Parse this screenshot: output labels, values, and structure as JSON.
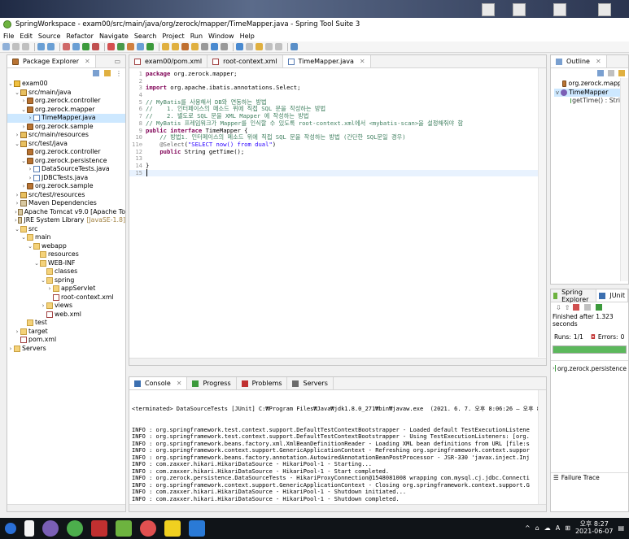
{
  "window": {
    "title": "SpringWorkspace - exam00/src/main/java/org/zerock/mapper/TimeMapper.java - Spring Tool Suite 3"
  },
  "menu": [
    "File",
    "Edit",
    "Source",
    "Refactor",
    "Navigate",
    "Search",
    "Project",
    "Run",
    "Window",
    "Help"
  ],
  "package_explorer": {
    "title": "Package Explorer",
    "rows": [
      {
        "indent": 0,
        "arrow": "v",
        "icon": "proj",
        "label": "exam00"
      },
      {
        "indent": 1,
        "arrow": "v",
        "icon": "src",
        "label": "src/main/java"
      },
      {
        "indent": 2,
        "arrow": ">",
        "icon": "pkg",
        "label": "org.zerock.controller"
      },
      {
        "indent": 2,
        "arrow": "v",
        "icon": "pkg",
        "label": "org.zerock.mapper"
      },
      {
        "indent": 3,
        "arrow": ">",
        "icon": "java",
        "label": "TimeMapper.java",
        "selected": true
      },
      {
        "indent": 2,
        "arrow": ">",
        "icon": "pkg",
        "label": "org.zerock.sample"
      },
      {
        "indent": 1,
        "arrow": ">",
        "icon": "src",
        "label": "src/main/resources"
      },
      {
        "indent": 1,
        "arrow": "v",
        "icon": "src",
        "label": "src/test/java"
      },
      {
        "indent": 2,
        "arrow": "",
        "icon": "pkg",
        "label": "org.zerock.controller"
      },
      {
        "indent": 2,
        "arrow": "v",
        "icon": "pkg",
        "label": "org.zerock.persistence"
      },
      {
        "indent": 3,
        "arrow": ">",
        "icon": "java",
        "label": "DataSourceTests.java"
      },
      {
        "indent": 3,
        "arrow": ">",
        "icon": "java",
        "label": "JDBCTests.java"
      },
      {
        "indent": 2,
        "arrow": ">",
        "icon": "pkg",
        "label": "org.zerock.sample"
      },
      {
        "indent": 1,
        "arrow": ">",
        "icon": "src",
        "label": "src/test/resources"
      },
      {
        "indent": 1,
        "arrow": ">",
        "icon": "lib",
        "label": "Maven Dependencies"
      },
      {
        "indent": 1,
        "arrow": ">",
        "icon": "lib",
        "label": "Apache Tomcat v9.0 [Apache To"
      },
      {
        "indent": 1,
        "arrow": ">",
        "icon": "lib",
        "label": "JRE System Library",
        "extra": "[JavaSE-1.8]"
      },
      {
        "indent": 1,
        "arrow": "v",
        "icon": "folder",
        "label": "src"
      },
      {
        "indent": 2,
        "arrow": "v",
        "icon": "folder",
        "label": "main"
      },
      {
        "indent": 3,
        "arrow": "v",
        "icon": "folder",
        "label": "webapp"
      },
      {
        "indent": 4,
        "arrow": "",
        "icon": "folder",
        "label": "resources"
      },
      {
        "indent": 4,
        "arrow": "v",
        "icon": "folder",
        "label": "WEB-INF"
      },
      {
        "indent": 5,
        "arrow": "",
        "icon": "folder",
        "label": "classes"
      },
      {
        "indent": 5,
        "arrow": "v",
        "icon": "folder",
        "label": "spring"
      },
      {
        "indent": 6,
        "arrow": ">",
        "icon": "folder",
        "label": "appServlet"
      },
      {
        "indent": 6,
        "arrow": "",
        "icon": "xml",
        "label": "root-context.xml"
      },
      {
        "indent": 5,
        "arrow": ">",
        "icon": "folder",
        "label": "views"
      },
      {
        "indent": 5,
        "arrow": "",
        "icon": "xml",
        "label": "web.xml"
      },
      {
        "indent": 2,
        "arrow": "",
        "icon": "folder",
        "label": "test"
      },
      {
        "indent": 1,
        "arrow": ">",
        "icon": "folder",
        "label": "target"
      },
      {
        "indent": 1,
        "arrow": "",
        "icon": "xml",
        "label": "pom.xml"
      },
      {
        "indent": 0,
        "arrow": ">",
        "icon": "folder",
        "label": "Servers"
      }
    ]
  },
  "editor": {
    "tabs": [
      {
        "label": "exam00/pom.xml",
        "active": false
      },
      {
        "label": "root-context.xml",
        "active": false
      },
      {
        "label": "TimeMapper.java",
        "active": true
      }
    ],
    "lines": [
      {
        "n": "1",
        "parts": [
          {
            "c": "kw",
            "t": "package"
          },
          {
            "c": "",
            "t": " org.zerock.mapper;"
          }
        ]
      },
      {
        "n": "2",
        "parts": []
      },
      {
        "n": "3",
        "parts": [
          {
            "c": "kw",
            "t": "import"
          },
          {
            "c": "",
            "t": " org.apache.ibatis.annotations.Select;"
          }
        ]
      },
      {
        "n": "4",
        "parts": []
      },
      {
        "n": "5",
        "parts": [
          {
            "c": "cm",
            "t": "// MyBatis를 사용해서 DB와 연동하는 방법"
          }
        ]
      },
      {
        "n": "6",
        "parts": [
          {
            "c": "cm",
            "t": "//    1. 인터페이스의 메소드 위에 직접 SQL 문을 작성하는 방법"
          }
        ]
      },
      {
        "n": "7",
        "parts": [
          {
            "c": "cm",
            "t": "//    2. 별도로 SQL 문을 XML Mapper 에 작성하는 방법"
          }
        ]
      },
      {
        "n": "8",
        "parts": [
          {
            "c": "cm",
            "t": "// MyBatis 프레임워크가 Mapper를 인식할 수 있도록 root-context.xml에서 <mybatis-scan>을 설정해줘야 함"
          }
        ]
      },
      {
        "n": "9",
        "parts": [
          {
            "c": "kw",
            "t": "public interface"
          },
          {
            "c": "",
            "t": " TimeMapper {"
          }
        ]
      },
      {
        "n": "10",
        "parts": [
          {
            "c": "cm",
            "t": "    // 방법1. 인터페이스의 메소드 위에 직접 SQL 문을 작성하는 방법 (간단한 SQL문일 경우)"
          }
        ]
      },
      {
        "n": "11⊖",
        "parts": [
          {
            "c": "an",
            "t": "    @Select"
          },
          {
            "c": "",
            "t": "("
          },
          {
            "c": "st",
            "t": "\"SELECT now() from dual\""
          },
          {
            "c": "",
            "t": ")"
          }
        ]
      },
      {
        "n": "12",
        "parts": [
          {
            "c": "",
            "t": "    "
          },
          {
            "c": "kw",
            "t": "public"
          },
          {
            "c": "",
            "t": " String getTime();"
          }
        ]
      },
      {
        "n": "13",
        "parts": []
      },
      {
        "n": "14",
        "parts": [
          {
            "c": "",
            "t": "}"
          }
        ]
      },
      {
        "n": "15",
        "parts": [],
        "current": true
      }
    ]
  },
  "outline": {
    "title": "Outline",
    "rows": [
      {
        "label": "org.zerock.mapper",
        "icon": "pkg"
      },
      {
        "label": "TimeMapper",
        "icon": "iface",
        "selected": true
      },
      {
        "label": "getTime() : String",
        "icon": "method"
      }
    ]
  },
  "junit": {
    "tabs": [
      "Spring Explorer",
      "JUnit"
    ],
    "finished": "Finished after 1.323 seconds",
    "runs_label": "Runs:",
    "runs_value": "1/1",
    "errors_label": "Errors:",
    "errors_value": "0",
    "progress": 1.0,
    "tree_item": "org.zerock.persistence",
    "failure_trace": "Failure Trace",
    "colors": {
      "progress": "#5cb85c"
    }
  },
  "console": {
    "tabs": [
      {
        "label": "Console",
        "active": true
      },
      {
        "label": "Progress",
        "active": false
      },
      {
        "label": "Problems",
        "active": false
      },
      {
        "label": "Servers",
        "active": false
      }
    ],
    "header": "<terminated> DataSourceTests [JUnit] C:₩Program Files₩Java₩jdk1.8.0_271₩bin₩javaw.exe  (2021. 6. 7. 오후 8:06:26 – 오후 8:06:28)",
    "lines": [
      "INFO : org.springframework.test.context.support.DefaultTestContextBootstrapper - Loaded default TestExecutionListene",
      "INFO : org.springframework.test.context.support.DefaultTestContextBootstrapper - Using TestExecutionListeners: [org.",
      "INFO : org.springframework.beans.factory.xml.XmlBeanDefinitionReader - Loading XML bean definitions from URL [file:s",
      "INFO : org.springframework.context.support.GenericApplicationContext - Refreshing org.springframework.context.suppor",
      "INFO : org.springframework.beans.factory.annotation.AutowiredAnnotationBeanPostProcessor - JSR-330 'javax.inject.Inj",
      "INFO : com.zaxxer.hikari.HikariDataSource - HikariPool-1 - Starting...",
      "INFO : com.zaxxer.hikari.HikariDataSource - HikariPool-1 - Start completed.",
      "INFO : org.zerock.persistence.DataSourceTests - HikariProxyConnection@1548081008 wrapping com.mysql.cj.jdbc.Connecti",
      "INFO : org.springframework.context.support.GenericApplicationContext - Closing org.springframework.context.support.G",
      "INFO : com.zaxxer.hikari.HikariDataSource - HikariPool-1 - Shutdown initiated...",
      "INFO : com.zaxxer.hikari.HikariDataSource - HikariPool-1 - Shutdown completed."
    ]
  },
  "taskbar": {
    "ime": "A",
    "time": "오후 8:27",
    "date": "2021-06-07"
  }
}
